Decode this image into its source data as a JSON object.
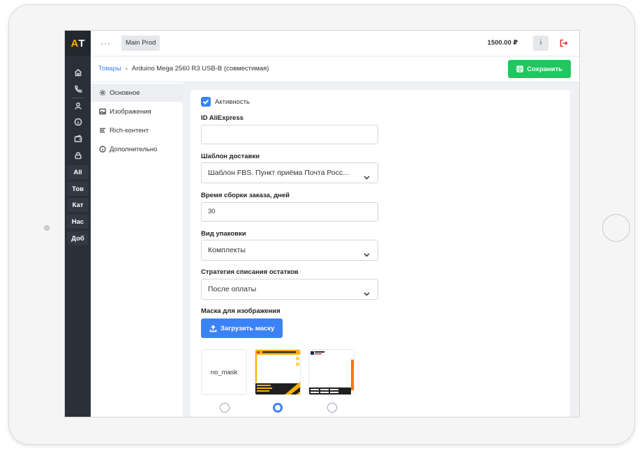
{
  "app": {
    "logo_a": "A",
    "logo_t": "T"
  },
  "topbar": {
    "dots": "···",
    "env": "Main Prod",
    "balance": "1500.00 ₽",
    "info": "i"
  },
  "rail": {
    "texts": [
      "All",
      "Тов",
      "Кат",
      "Нас",
      "Доб"
    ]
  },
  "breadcrumb": {
    "root": "Товары",
    "current": "Arduino Mega 2560 R3 USB-B (совместимая)"
  },
  "actions": {
    "save": "Сохранить",
    "upload_mask": "Загрузить маску"
  },
  "sections": [
    "Основное",
    "Изображения",
    "Rich-контент",
    "Дополнительно"
  ],
  "form": {
    "active_label": "Активность",
    "active_checked": true,
    "aliexpress_label": "ID AliExpress",
    "aliexpress_value": "",
    "delivery_label": "Шаблон доставки",
    "delivery_value": "Шаблон FBS. Пункт приёма Почта Росс...",
    "assembly_label": "Время сборки заказа, дней",
    "assembly_value": "30",
    "packaging_label": "Вид упаковки",
    "packaging_value": "Комплекты",
    "stock_label": "Стратегия списания остатков",
    "stock_value": "После оплаты",
    "mask_label": "Маска для изображения"
  },
  "masks": {
    "nomask_label": "no_mask",
    "selected_index": 1
  },
  "colors": {
    "accent": "#3b82f6",
    "success": "#22c55e",
    "rail": "#2b3038",
    "danger": "#e53935",
    "brand": "#ffb000"
  }
}
